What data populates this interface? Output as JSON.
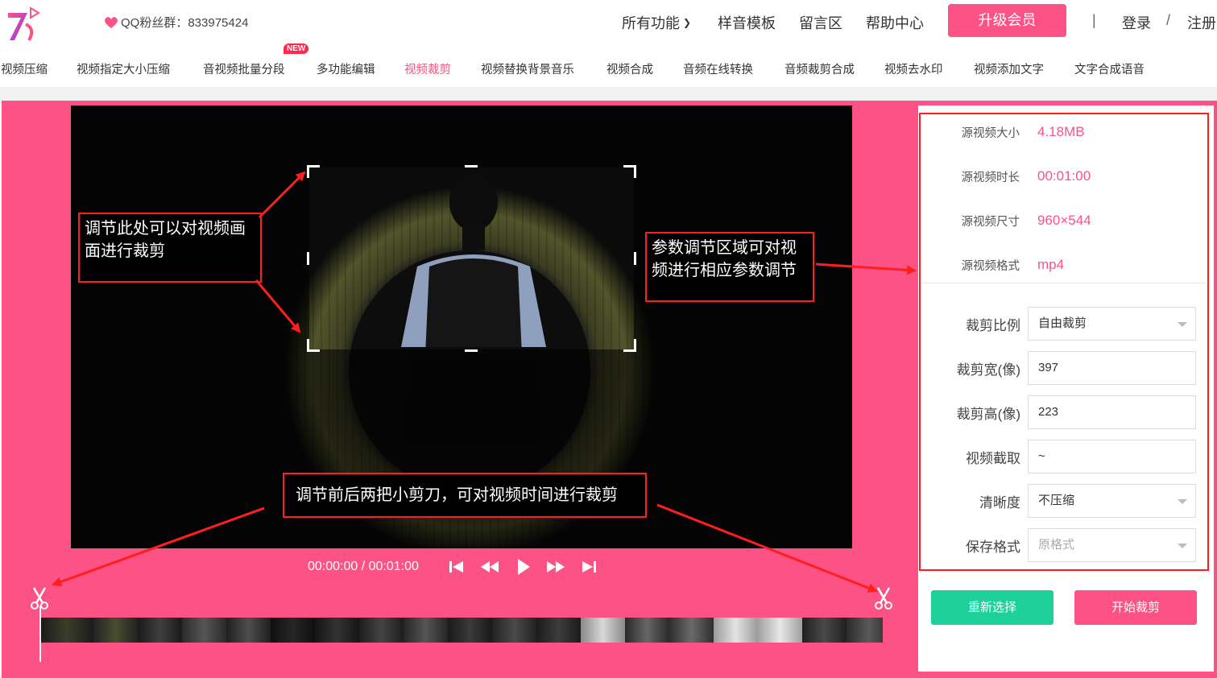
{
  "header": {
    "qq_group": "QQ粉丝群：833975424",
    "nav": [
      "所有功能",
      "样音模板",
      "留言区",
      "帮助中心"
    ],
    "upgrade_label": "升级会员",
    "separator": "|",
    "login_label": "登录",
    "slash": "/",
    "register_label": "注册"
  },
  "subnav": {
    "items": [
      "视频压缩",
      "视频指定大小压缩",
      "音视频批量分段",
      "多功能编辑",
      "视频裁剪",
      "视频替换背景音乐",
      "视频合成",
      "音频在线转换",
      "音频裁剪合成",
      "视频去水印",
      "视频添加文字",
      "文字合成语音"
    ],
    "active_index": 4,
    "new_badge": "NEW"
  },
  "annotations": {
    "crop_hint": "调节此处可以对视频画面进行裁剪",
    "params_hint": "参数调节区域可对视频进行相应参数调节",
    "trim_hint": "调节前后两把小剪刀，可对视频时间进行裁剪"
  },
  "player": {
    "time": "00:00:00 / 00:01:00"
  },
  "source_info": [
    {
      "label": "源视频大小",
      "value": "4.18MB"
    },
    {
      "label": "源视频时长",
      "value": "00:01:00"
    },
    {
      "label": "源视频尺寸",
      "value": "960×544"
    },
    {
      "label": "源视频格式",
      "value": "mp4"
    }
  ],
  "form": {
    "ratio_label": "裁剪比例",
    "ratio_value": "自由裁剪",
    "width_label": "裁剪宽(像)",
    "width_value": "397",
    "height_label": "裁剪高(像)",
    "height_value": "223",
    "clip_label": "视频截取",
    "clip_value": "~",
    "quality_label": "清晰度",
    "quality_value": "不压缩",
    "format_label": "保存格式",
    "format_placeholder": "原格式"
  },
  "buttons": {
    "reselect": "重新选择",
    "start": "开始裁剪"
  },
  "colors": {
    "accent": "#fc5285",
    "green": "#1ed09a",
    "annotation_red": "#ff1e1e"
  }
}
